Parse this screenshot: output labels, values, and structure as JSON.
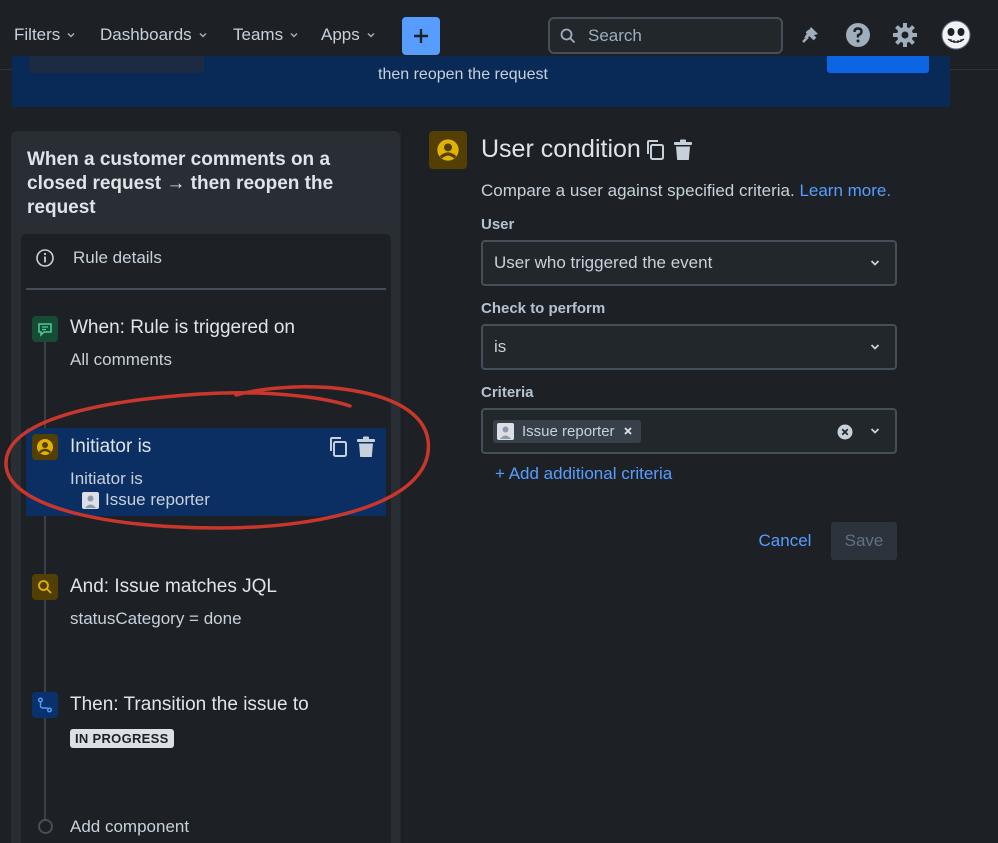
{
  "nav": {
    "items": [
      {
        "label": "Filters"
      },
      {
        "label": "Dashboards"
      },
      {
        "label": "Teams"
      },
      {
        "label": "Apps"
      }
    ],
    "create_icon": "plus-icon",
    "search_placeholder": "Search",
    "icons": [
      "notifications-icon",
      "help-icon",
      "settings-icon",
      "avatar"
    ]
  },
  "banner": {
    "text": "then reopen the request"
  },
  "rule": {
    "title": "When a customer comments on a closed request → then reopen the request",
    "details_label": "Rule details",
    "steps": [
      {
        "title": "When: Rule is triggered on",
        "sub": "All comments",
        "icon": "comment-icon"
      },
      {
        "title": "Initiator is",
        "sub": "Initiator is",
        "value": "Issue reporter",
        "icon": "user-icon"
      },
      {
        "title": "And: Issue matches JQL",
        "sub": "statusCategory = done",
        "icon": "search-icon"
      },
      {
        "title": "Then: Transition the issue to",
        "lozenge": "IN PROGRESS",
        "icon": "transition-icon"
      }
    ],
    "add_component": "Add component"
  },
  "condition": {
    "title": "User condition",
    "description": "Compare a user against specified criteria.",
    "learn_more": "Learn more.",
    "user_label": "User",
    "user_value": "User who triggered the event",
    "check_label": "Check to perform",
    "check_value": "is",
    "criteria_label": "Criteria",
    "criteria_tag": "Issue reporter",
    "add_criteria": "+ Add additional criteria",
    "cancel": "Cancel",
    "save": "Save"
  },
  "colors": {
    "background": "#1d2125",
    "panel": "#282e33",
    "selected": "#0c2f63",
    "accent": "#579dff",
    "annotation": "#c9372c"
  }
}
